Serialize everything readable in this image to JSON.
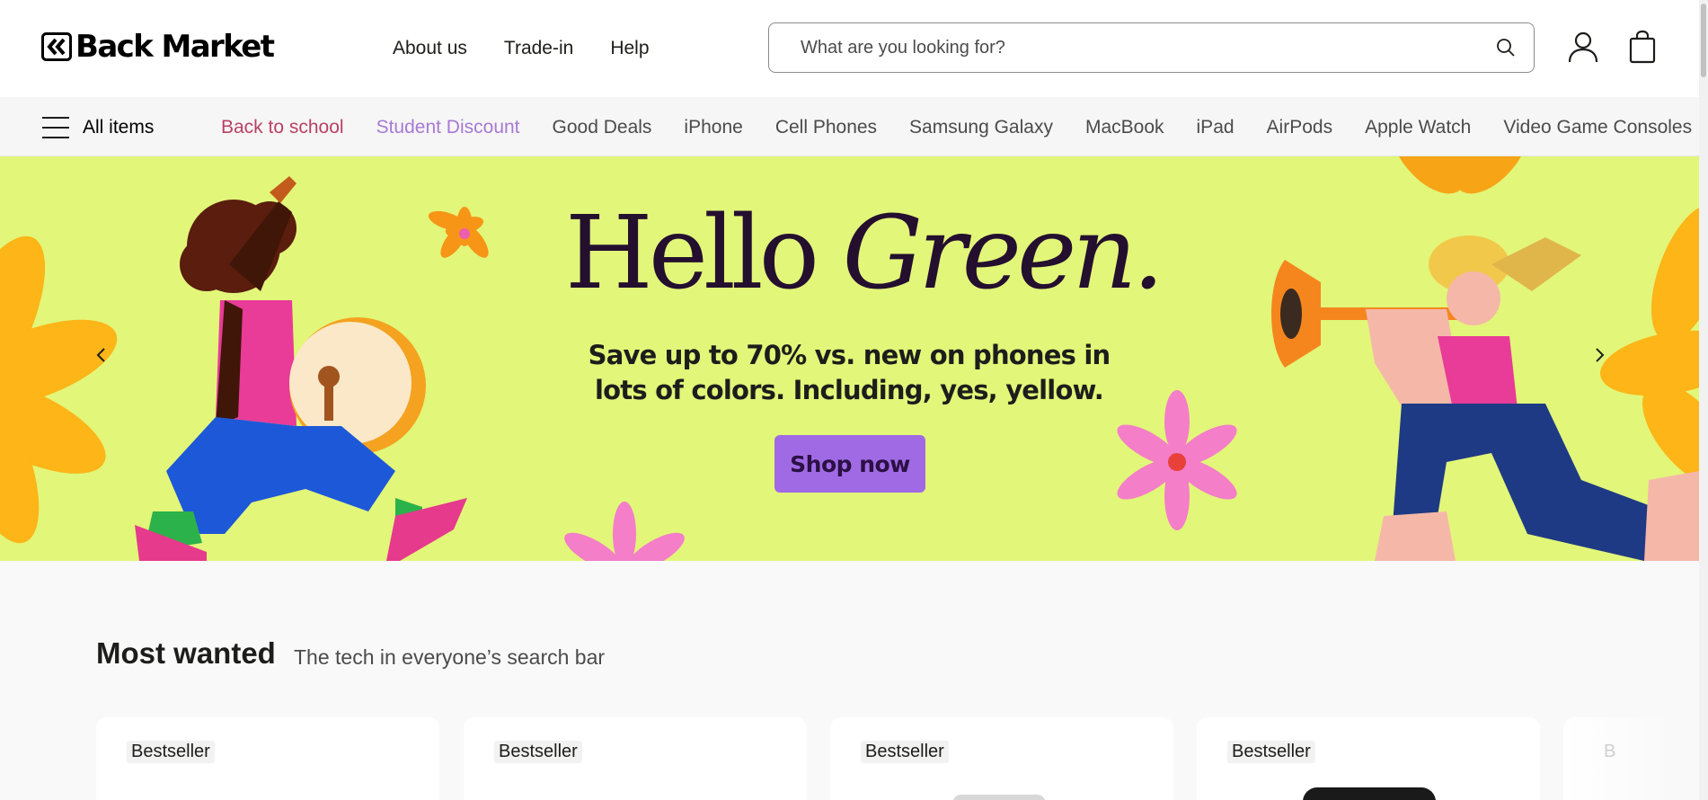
{
  "header": {
    "logo_text": "Back Market",
    "nav": [
      "About us",
      "Trade-in",
      "Help"
    ],
    "search_placeholder": "What are you looking for?"
  },
  "categories": {
    "all_items_label": "All items",
    "items": [
      {
        "label": "Back to school",
        "color": "#b94165"
      },
      {
        "label": "Student Discount",
        "color": "#a77ad3"
      },
      {
        "label": "Good Deals"
      },
      {
        "label": "iPhone"
      },
      {
        "label": "Cell Phones"
      },
      {
        "label": "Samsung Galaxy"
      },
      {
        "label": "MacBook"
      },
      {
        "label": "iPad"
      },
      {
        "label": "AirPods"
      },
      {
        "label": "Apple Watch"
      },
      {
        "label": "Video Game Consoles"
      }
    ]
  },
  "hero": {
    "title_regular": "Hello",
    "title_italic": "Green.",
    "subtitle": "Save up to 70% vs. new on phones in lots of colors. Including, yes, yellow.",
    "button_label": "Shop now",
    "background_color": "#e2f679",
    "button_color": "#a16ae5"
  },
  "most_wanted": {
    "title": "Most wanted",
    "subtitle": "The tech in everyone’s search bar",
    "cards": [
      {
        "badge": "Bestseller"
      },
      {
        "badge": "Bestseller"
      },
      {
        "badge": "Bestseller"
      },
      {
        "badge": "Bestseller"
      },
      {
        "badge": "B"
      }
    ]
  }
}
